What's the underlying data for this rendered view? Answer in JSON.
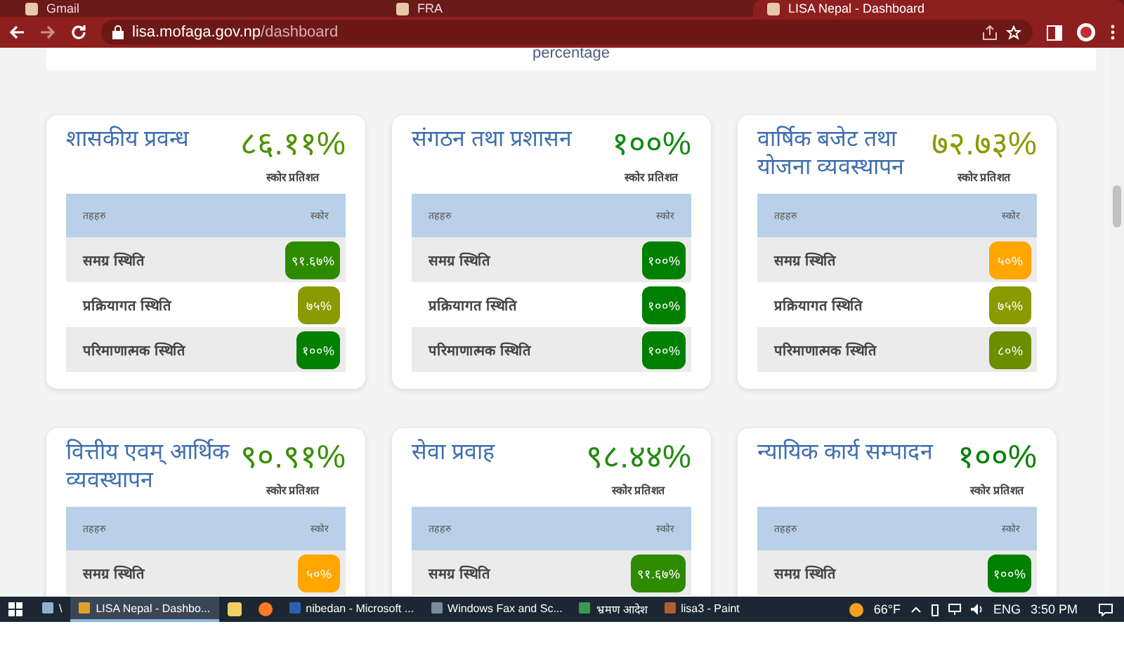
{
  "browser": {
    "tabs": [
      {
        "title": "Gmail",
        "selected": false
      },
      {
        "title": "FRA",
        "selected": false
      },
      {
        "title": "LISA Nepal - Dashboard",
        "selected": true
      }
    ],
    "url_host": "lisa.mofaga.gov.np",
    "url_path": "/dashboard"
  },
  "page": {
    "top_text": "percentage",
    "cards": [
      {
        "title": "शासकीय प्रवन्ध",
        "score": "८६.११%",
        "color": "#4f9200",
        "score_caption": "स्कोर प्रतिशत",
        "columns": [
          "तहहरु",
          "स्कोर"
        ],
        "rows": [
          {
            "label": "समग्र स्थिति",
            "score": "९१.६७%",
            "color": "#2e8b00"
          },
          {
            "label": "प्रक्रियागत स्थिति",
            "score": "७५%",
            "color": "#8a9a00"
          },
          {
            "label": "परिमाणात्मक स्थिति",
            "score": "१००%",
            "color": "#008000"
          }
        ]
      },
      {
        "title": "संगठन तथा प्रशासन",
        "score": "१००%",
        "color": "#118a11",
        "score_caption": "स्कोर प्रतिशत",
        "columns": [
          "तहहरु",
          "स्कोर"
        ],
        "rows": [
          {
            "label": "समग्र स्थिति",
            "score": "१००%",
            "color": "#008000"
          },
          {
            "label": "प्रक्रियागत स्थिति",
            "score": "१००%",
            "color": "#008000"
          },
          {
            "label": "परिमाणात्मक स्थिति",
            "score": "१००%",
            "color": "#008000"
          }
        ]
      },
      {
        "title": "वार्षिक बजेट तथा योजना व्यवस्थापन",
        "score": "७२.७३%",
        "color": "#8a9a00",
        "score_caption": "स्कोर प्रतिशत",
        "columns": [
          "तहहरु",
          "स्कोर"
        ],
        "rows": [
          {
            "label": "समग्र स्थिति",
            "score": "५०%",
            "color": "#ffa500"
          },
          {
            "label": "प्रक्रियागत स्थिति",
            "score": "७५%",
            "color": "#8a9a00"
          },
          {
            "label": "परिमाणात्मक स्थिति",
            "score": "८०%",
            "color": "#6b8e00"
          }
        ]
      },
      {
        "title": "वित्तीय एवम् आर्थिक व्यवस्थापन",
        "score": "९०.९१%",
        "color": "#3a8f00",
        "score_caption": "स्कोर प्रतिशत",
        "columns": [
          "तहहरु",
          "स्कोर"
        ],
        "rows": [
          {
            "label": "समग्र स्थिति",
            "score": "५०%",
            "color": "#ffa500"
          }
        ]
      },
      {
        "title": "सेवा प्रवाह",
        "score": "९८.४४%",
        "color": "#228b10",
        "score_caption": "स्कोर प्रतिशत",
        "columns": [
          "तहहरु",
          "स्कोर"
        ],
        "rows": [
          {
            "label": "समग्र स्थिति",
            "score": "९१.६७%",
            "color": "#2e8b00"
          }
        ]
      },
      {
        "title": "न्यायिक कार्य सम्पादन",
        "score": "१००%",
        "color": "#008000",
        "score_caption": "स्कोर प्रतिशत",
        "columns": [
          "तहहरु",
          "स्कोर"
        ],
        "rows": [
          {
            "label": "समग्र स्थिति",
            "score": "१००%",
            "color": "#008000"
          }
        ]
      }
    ]
  },
  "taskbar": {
    "items": [
      {
        "label": "\\",
        "selected": false
      },
      {
        "label": "LISA Nepal - Dashbo...",
        "selected": true
      },
      {
        "label": "nibedan - Microsoft ...",
        "selected": false
      },
      {
        "label": "Windows Fax and Sc...",
        "selected": false
      },
      {
        "label": "भ्रमण आदेश",
        "selected": false
      },
      {
        "label": "lisa3 - Paint",
        "selected": false
      }
    ],
    "temperature": "66°F",
    "language": "ENG",
    "time": "3:50 PM"
  }
}
